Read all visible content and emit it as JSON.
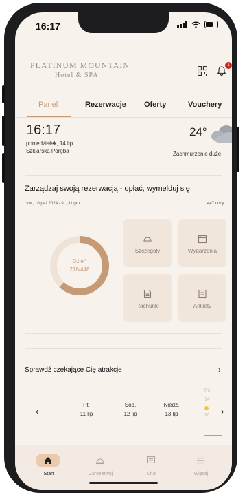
{
  "status": {
    "time": "16:17"
  },
  "header": {
    "brand_line1": "PLATINUM MOUNTAIN",
    "brand_line2": "Hotel & SPA",
    "notifications_count": "1"
  },
  "tabs": [
    {
      "label": "Panel",
      "active": true
    },
    {
      "label": "Rezerwacje",
      "active": false
    },
    {
      "label": "Oferty",
      "active": false
    },
    {
      "label": "Vouchery",
      "active": false
    }
  ],
  "clock_card": {
    "time": "16:17",
    "date": "poniedziałek, 14 lip",
    "location": "Szklarska Poręba",
    "temperature": "24°",
    "weather": "Zachmurzenie duże"
  },
  "reservation": {
    "title": "Zarządzaj swoją rezerwacją - opłać, wymelduj się",
    "dates": "czw., 10 paź 2024 - śr., 31 gru",
    "nights": "447 nocy",
    "progress_day_label": "Dzień",
    "progress_value": "278/448",
    "progress_fraction": 0.62,
    "tiles": [
      {
        "label": "Szczegóły",
        "icon": "bell-dome-icon"
      },
      {
        "label": "Wydarzenia",
        "icon": "calendar-icon"
      },
      {
        "label": "Rachunki",
        "icon": "receipt-icon"
      },
      {
        "label": "Ankiety",
        "icon": "survey-icon"
      }
    ]
  },
  "attractions": {
    "title": "Sprawdź czekające Cię atrakcje",
    "days": [
      {
        "name": "Pt.",
        "date": "11 lip"
      },
      {
        "name": "Sob.",
        "date": "12 lip"
      },
      {
        "name": "Niedz.",
        "date": "13 lip"
      }
    ],
    "partial_day": {
      "name": "Pc",
      "num": "14",
      "extra": "2/"
    }
  },
  "bottom_nav": [
    {
      "label": "Start",
      "icon": "home-icon",
      "active": true
    },
    {
      "label": "Zarezerwuj",
      "icon": "bell-dome-icon",
      "active": false
    },
    {
      "label": "Chat",
      "icon": "chat-icon",
      "active": false
    },
    {
      "label": "Więcej",
      "icon": "menu-icon",
      "active": false
    }
  ],
  "colors": {
    "accent": "#c79a76",
    "background": "#f8f2ec",
    "tile": "#f1e6dc",
    "badge": "#c8231c"
  }
}
